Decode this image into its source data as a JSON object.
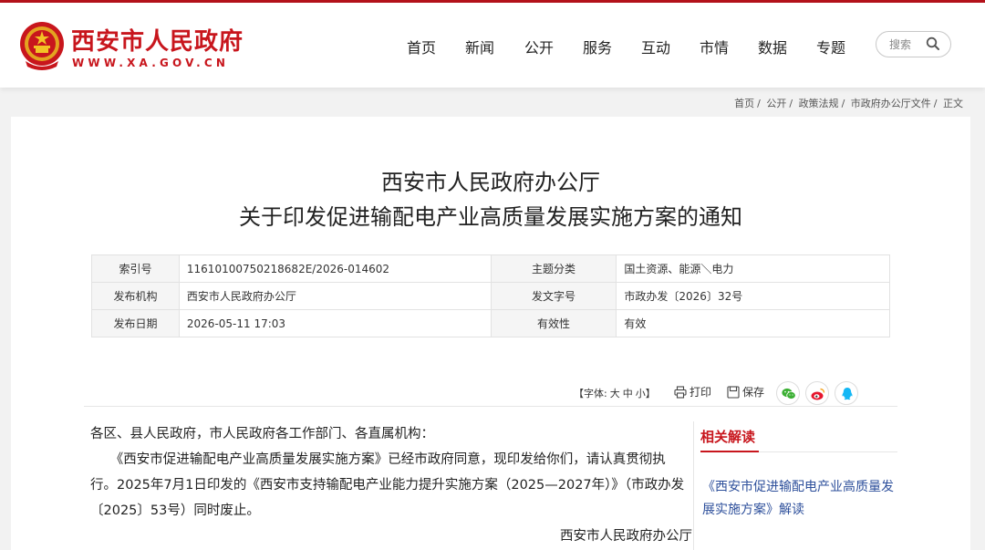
{
  "header": {
    "site_name": "西安市人民政府",
    "site_domain": "WWW.XA.GOV.CN",
    "nav": [
      "首页",
      "新闻",
      "公开",
      "服务",
      "互动",
      "市情",
      "数据",
      "专题"
    ],
    "search_placeholder": "搜索"
  },
  "breadcrumb": [
    "首页",
    "公开",
    "政策法规",
    "市政府办公厅文件",
    "正文"
  ],
  "article": {
    "title_line1": "西安市人民政府办公厅",
    "title_line2": "关于印发促进输配电产业高质量发展实施方案的通知",
    "meta": {
      "index_label": "索引号",
      "index_value": "11610100750218682E/2026-014602",
      "topic_label": "主题分类",
      "topic_value": "国土资源、能源＼电力",
      "publisher_label": "发布机构",
      "publisher_value": "西安市人民政府办公厅",
      "doc_no_label": "发文字号",
      "doc_no_value": "市政办发〔2026〕32号",
      "date_label": "发布日期",
      "date_value": "2026-05-11 17:03",
      "validity_label": "有效性",
      "validity_value": "有效"
    },
    "toolbar": {
      "font_prefix": "【字体:",
      "font_large": "大",
      "font_medium": "中",
      "font_small": "小",
      "font_suffix": "】",
      "print": "打印",
      "save": "保存",
      "share_icons": [
        "wechat-icon",
        "weibo-icon",
        "qq-icon"
      ]
    },
    "body": {
      "salutation": "各区、县人民政府，市人民政府各工作部门、各直属机构：",
      "para1_line1": "　　《西安市促进输配电产业高质量发展实施方案》已经市政府同意，现印发给你们，请认真贯彻执",
      "para1_line2": "行。2025年7月1日印发的《西安市支持输配电产业能力提升实施方案（2025—2027年）》（市政办发",
      "para1_line3": "〔2025〕53号）同时废止。",
      "signature": "西安市人民政府办公厅"
    }
  },
  "related": {
    "title": "相关解读",
    "link": "《西安市促进输配电产业高质量发展实施方案》解读"
  },
  "colors": {
    "brand_red": "#c8161d",
    "link_blue": "#2d4f9b",
    "wechat_green": "#3cb034",
    "weibo_red": "#e6162d",
    "qq_blue": "#12b7f5"
  }
}
